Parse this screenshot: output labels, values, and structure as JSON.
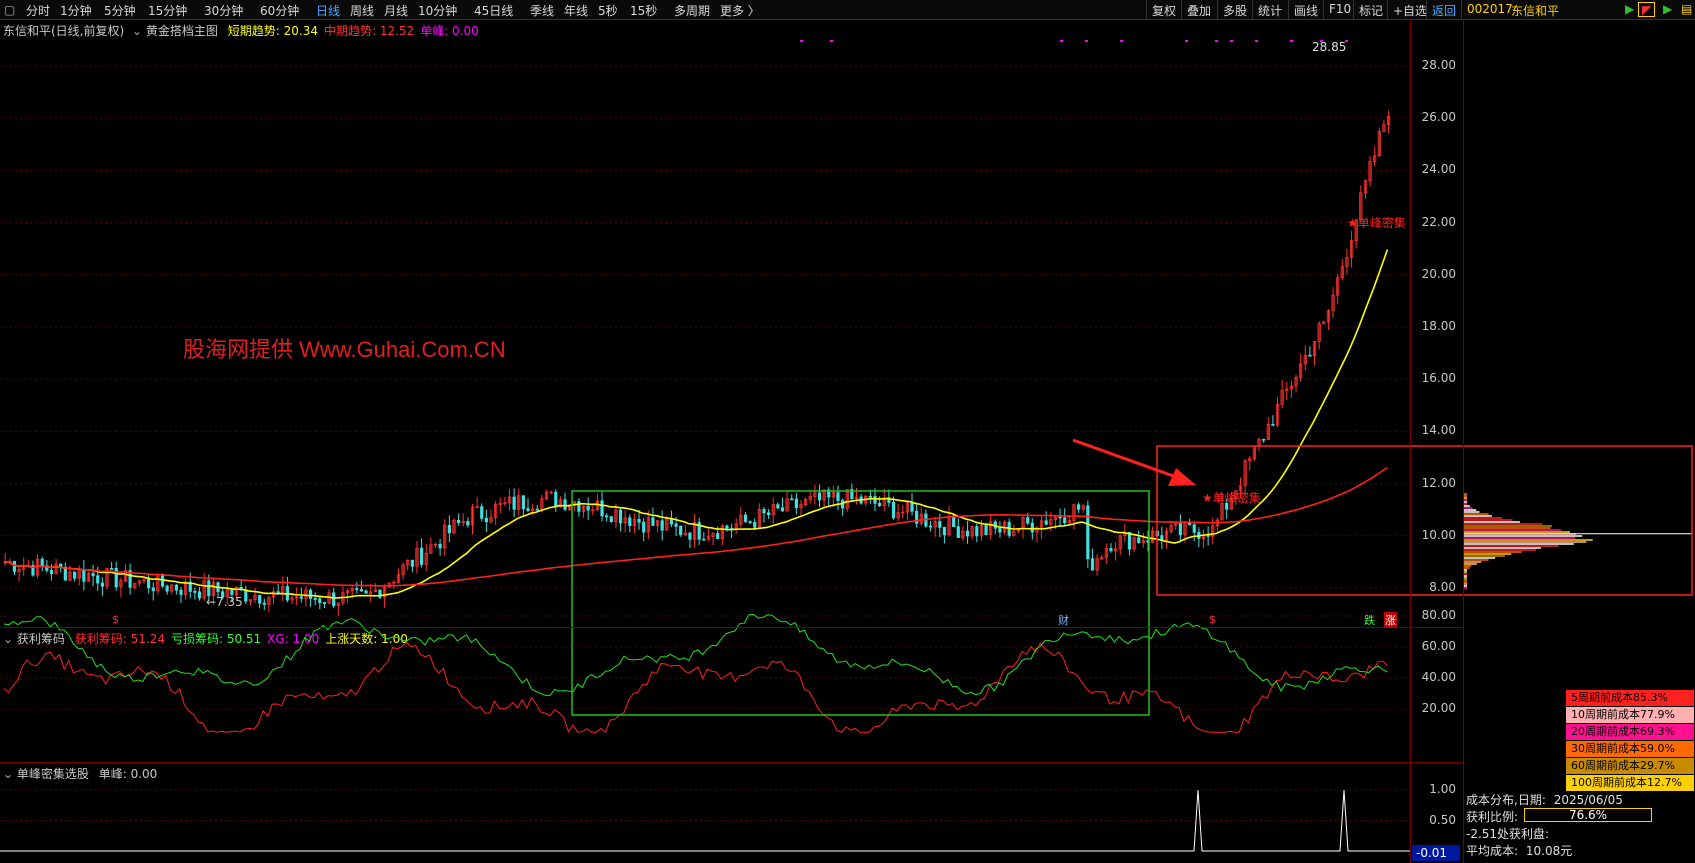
{
  "toolbar": {
    "periods": [
      "分时",
      "1分钟",
      "5分钟",
      "15分钟",
      "30分钟",
      "60分钟",
      "日线",
      "周线",
      "月线",
      "10分钟",
      "45日线",
      "季线",
      "年线",
      "5秒",
      "15秒",
      "多周期",
      "更多 〉"
    ],
    "active": "日线",
    "right_tools": [
      "复权",
      "叠加",
      "多股",
      "统计",
      "画线",
      "F10",
      "标记",
      "+自选",
      "返回"
    ],
    "stock_code": "002017",
    "stock_name": "东信和平"
  },
  "main_panel": {
    "title": "东信和平(日线,前复权)",
    "indicator_name": "黄金搭档主图",
    "items": [
      {
        "label": "短期趋势: ",
        "value": "20.34",
        "color": "#ffff00"
      },
      {
        "label": "中期趋势: ",
        "value": "12.52",
        "color": "#ff3030"
      },
      {
        "label": "单峰: ",
        "value": "0.00",
        "color": "#ff00ff"
      }
    ],
    "y_ticks": [
      "28.00",
      "26.00",
      "24.00",
      "22.00",
      "20.00",
      "18.00",
      "16.00",
      "14.00",
      "12.00",
      "10.00",
      "8.00"
    ],
    "high_label": "28.85",
    "low_label": "←7.35",
    "signal_label": "★单峰密集",
    "watermark": "股海网提供 Www.Guhai.Com.CN",
    "markers": [
      "$",
      "财",
      "$",
      "跌",
      "涨"
    ]
  },
  "sub1": {
    "title": "获利筹码",
    "items": [
      {
        "label": "获利筹码: ",
        "value": "51.24",
        "color": "#ff3030"
      },
      {
        "label": "亏损筹码: ",
        "value": "50.51",
        "color": "#30ff30"
      },
      {
        "label": "XG: ",
        "value": "1.00",
        "color": "#ff00ff"
      },
      {
        "label": "上涨天数: ",
        "value": "1.00",
        "color": "#ffff00"
      }
    ],
    "y_ticks": [
      "80.00",
      "60.00",
      "40.00",
      "20.00"
    ]
  },
  "sub2": {
    "title": "单峰密集选股",
    "item_label": "单峰: ",
    "item_value": "0.00",
    "y_ticks": [
      "1.00",
      "0.50"
    ],
    "current_value": "-0.01"
  },
  "chip_legend": [
    {
      "text": "5周期前成本85.3%",
      "bg": "#ff2020",
      "fg": "#000000"
    },
    {
      "text": "10周期前成本77.9%",
      "bg": "#ffb0b0",
      "fg": "#000000"
    },
    {
      "text": "20周期前成本69.3%",
      "bg": "#ff1090",
      "fg": "#000000"
    },
    {
      "text": "30周期前成本59.0%",
      "bg": "#ff6a00",
      "fg": "#000000"
    },
    {
      "text": "60周期前成本29.7%",
      "bg": "#c88a00",
      "fg": "#000000"
    },
    {
      "text": "100周期前成本12.7%",
      "bg": "#ffd000",
      "fg": "#000000"
    }
  ],
  "chip_info": {
    "date_label": "成本分布,日期:",
    "date": "2025/06/05",
    "profit_label": "获利比例:",
    "profit_value": "76.6%",
    "profit_ratio": 0.766,
    "profit_disk": "-2.51处获利盘:",
    "avg_cost_label": "平均成本:",
    "avg_cost": "10.08元"
  }
}
